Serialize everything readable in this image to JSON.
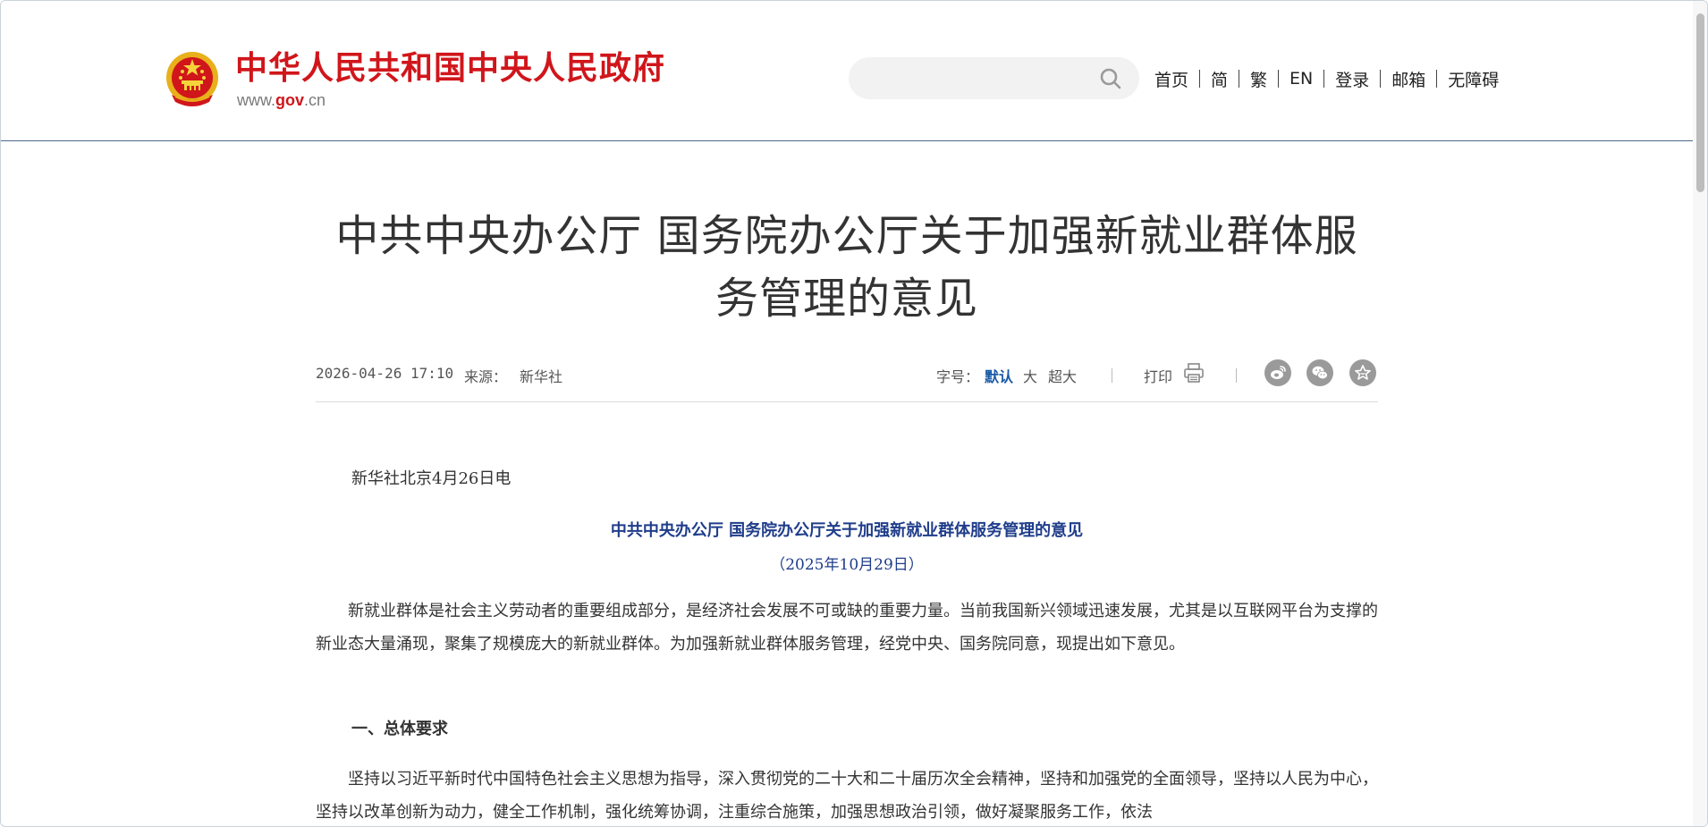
{
  "header": {
    "site_name": "中华人民共和国中央人民政府",
    "url_prefix": "www.",
    "url_gov": "gov",
    "url_suffix": ".cn",
    "emblem_icon": "national-emblem-icon",
    "search": {
      "placeholder": "",
      "icon": "search-icon"
    },
    "nav": [
      "首页",
      "简",
      "繁",
      "EN",
      "登录",
      "邮箱",
      "无障碍"
    ]
  },
  "article": {
    "title": "中共中央办公厅 国务院办公厅关于加强新就业群体服务管理的意见",
    "date": "2026-04-26 17:10",
    "source_label": "来源：",
    "source": "新华社",
    "font_size_label": "字号：",
    "font_size_options": [
      "默认",
      "大",
      "超大"
    ],
    "font_size_selected": "默认",
    "print_label": "打印",
    "share_icons": [
      "weibo-icon",
      "wechat-icon",
      "favorite-icon"
    ],
    "dateline": "新华社北京4月26日电",
    "doc_title": "中共中央办公厅 国务院办公厅关于加强新就业群体服务管理的意见",
    "doc_date": "（2025年10月29日）",
    "paragraph1": "新就业群体是社会主义劳动者的重要组成部分，是经济社会发展不可或缺的重要力量。当前我国新兴领域迅速发展，尤其是以互联网平台为支撑的新业态大量涌现，聚集了规模庞大的新就业群体。为加强新就业群体服务管理，经党中央、国务院同意，现提出如下意见。",
    "heading1": "一、总体要求",
    "paragraph2": "坚持以习近平新时代中国特色社会主义思想为指导，深入贯彻党的二十大和二十届历次全会精神，坚持和加强党的全面领导，坚持以人民为中心，坚持以改革创新为动力，健全工作机制，强化统筹协调，注重综合施策，加强思想政治引领，做好凝聚服务工作，依法"
  },
  "colors": {
    "brand_red": "#d0161b",
    "doc_title_blue": "#1f3d8a",
    "selected_blue": "#1a5aa6"
  }
}
